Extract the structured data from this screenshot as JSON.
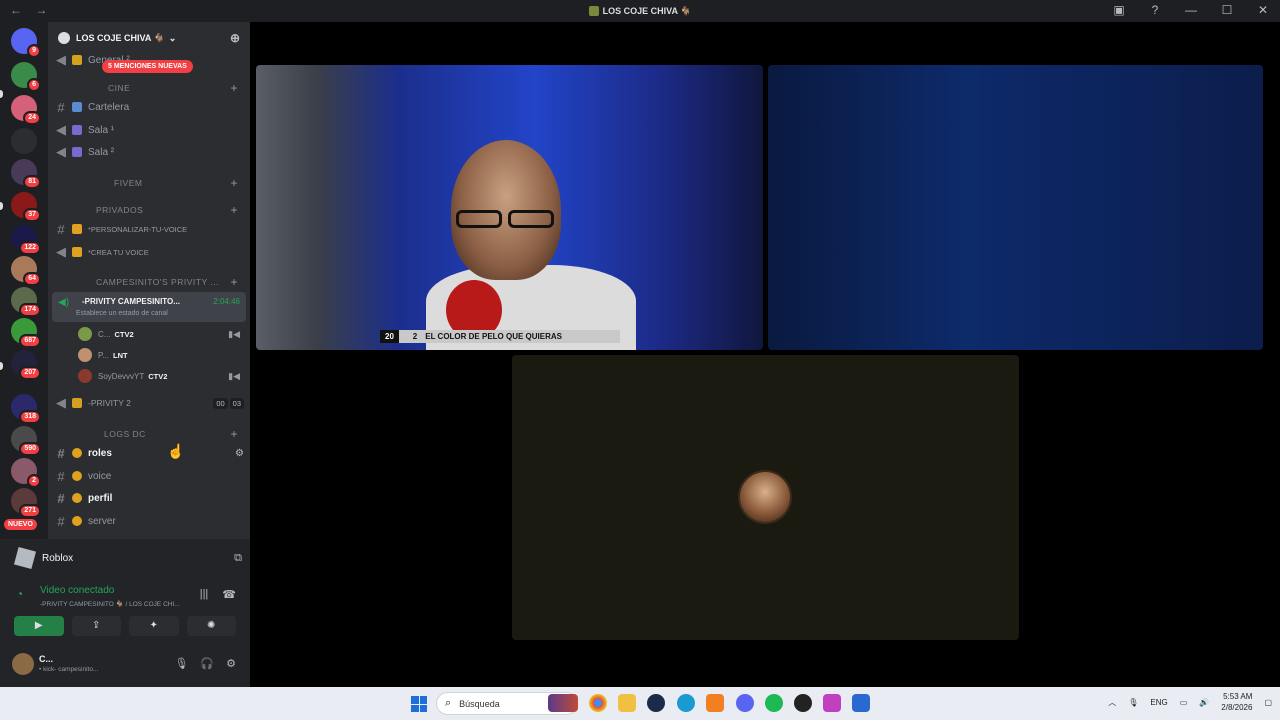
{
  "window": {
    "title": "LOS COJE CHIVA 🐐",
    "nav_back": "←",
    "nav_forward": "→",
    "controls": [
      "—",
      "☐",
      "✕"
    ]
  },
  "servers": {
    "home_badge": "9",
    "badges": [
      "6",
      "24",
      "",
      "81",
      "37",
      "122",
      "64",
      "174",
      "687",
      "207",
      "318",
      "590",
      "2",
      "271"
    ],
    "new_label": "NUEVO"
  },
  "guild": {
    "name": "LOS COJE CHIVA 🐐",
    "mention_pill": "5 MENCIONES NUEVAS",
    "top_channel": "General ²",
    "categories": {
      "cine": "CINE",
      "fivem": "FIVEM",
      "privados": "PRIVADOS",
      "campesinito": "CAMPESINITO'S PRIVITY ...",
      "logs": "LOGS DC"
    },
    "channels": {
      "cartelera": "Cartelera",
      "sala1": "Sala ¹",
      "sala2": "Sala ²",
      "personalizar": "*PERSONALIZAR-TU-VOICE",
      "crea": "*CREA TU VOICE",
      "privity2": "-PRIVITY 2",
      "roles": "roles",
      "voice": "voice",
      "perfil": "perfil",
      "server": "server"
    },
    "active_voice": {
      "name": "-PRIVITY CAMPESINITO...",
      "time": "2:04:46",
      "status": "Establece un estado de canal"
    },
    "voice_users": [
      {
        "name": "C...",
        "tag": "CTV2"
      },
      {
        "name": "P...",
        "tag": "LNT"
      },
      {
        "name": "SoyDevvvYT",
        "tag": "CTV2"
      }
    ],
    "privity2_counts": [
      "00",
      "03"
    ]
  },
  "panel": {
    "activity": "Roblox",
    "vc_title": "Video conectado",
    "vc_sub": "-PRIVITY CAMPESINITO 🐐 / LOS COJE CHI...",
    "user_name": "C...",
    "user_status": "• kick- campesinito..."
  },
  "stage": {
    "overlay_left": "20",
    "overlay_text": "EL COLOR DE PELO QUE QUIERAS",
    "overlay_right": "2"
  },
  "taskbar": {
    "search_placeholder": "Búsqueda",
    "lang": "ENG",
    "time": "5:53 AM",
    "date": "2/8/2026"
  }
}
